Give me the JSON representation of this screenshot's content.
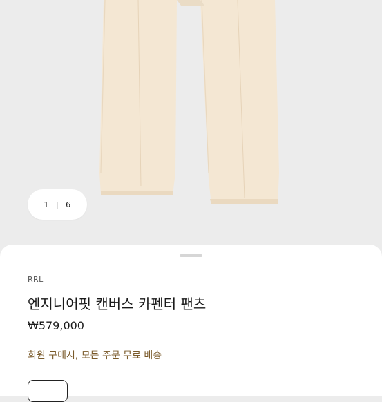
{
  "gallery": {
    "current": "1",
    "total": "6",
    "separator": "|"
  },
  "product": {
    "brand": "RRL",
    "name": "엔지니어핏 캔버스 카펜터 팬츠",
    "price": "₩579,000",
    "promo": "회원 구매시, 모든 주문 무료 배송"
  },
  "colors": {
    "background": "#ececec",
    "fabric": "#f3e6d2",
    "promo_text": "#7a5a2a"
  }
}
